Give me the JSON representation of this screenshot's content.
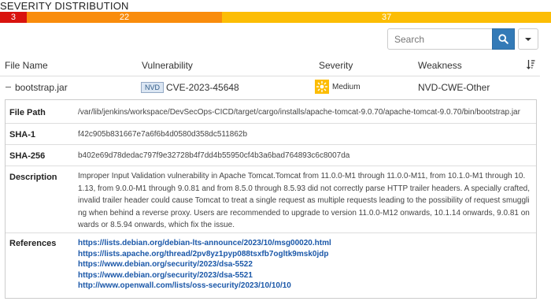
{
  "severity_distribution": {
    "title": "SEVERITY DISTRIBUTION",
    "segments": [
      {
        "label": "3",
        "value": 3,
        "color": "#d9130e"
      },
      {
        "label": "22",
        "value": 22,
        "color": "#f98c0c"
      },
      {
        "label": "37",
        "value": 37,
        "color": "#fcbd05"
      }
    ]
  },
  "search": {
    "placeholder": "Search"
  },
  "table": {
    "columns": {
      "file_name": "File Name",
      "vulnerability": "Vulnerability",
      "severity": "Severity",
      "weakness": "Weakness"
    },
    "row": {
      "file_name": "bootstrap.jar",
      "source_badge": "NVD",
      "cve": "CVE-2023-45648",
      "severity": "Medium",
      "severity_icon_color": "#fcbd05",
      "weakness": "NVD-CWE-Other"
    }
  },
  "details": {
    "file_path_label": "File Path",
    "file_path": "/var/lib/jenkins/workspace/DevSecOps-CICD/target/cargo/installs/apache-tomcat-9.0.70/apache-tomcat-9.0.70/bin/bootstrap.jar",
    "sha1_label": "SHA-1",
    "sha1": "f42c905b831667e7a6f6b4d0580d358dc511862b",
    "sha256_label": "SHA-256",
    "sha256": "b402e69d78dedac797f9e32728b4f7dd4b55950cf4b3a6bad764893c6c8007da",
    "description_label": "Description",
    "description": "Improper Input Validation vulnerability in Apache Tomcat.Tomcat from 11.0.0-M1 through 11.0.0-M11, from 10.1.0-M1 through 10.1.13, from 9.0.0-M1 through 9.0.81 and from 8.5.0 through 8.5.93 did not correctly parse HTTP trailer headers. A specially crafted, invalid trailer header could cause Tomcat to treat a single request as multiple requests leading to the possibility of request smuggling when behind a reverse proxy. Users are recommended to upgrade to version 11.0.0-M12 onwards, 10.1.14 onwards, 9.0.81 onwards or 8.5.94 onwards, which fix the issue.",
    "references_label": "References",
    "references": [
      "https://lists.debian.org/debian-lts-announce/2023/10/msg00020.html",
      "https://lists.apache.org/thread/2pv8yz1pyp088tsxfb7ogltk9msk0jdp",
      "https://www.debian.org/security/2023/dsa-5522",
      "https://www.debian.org/security/2023/dsa-5521",
      "http://www.openwall.com/lists/oss-security/2023/10/10/10"
    ]
  }
}
